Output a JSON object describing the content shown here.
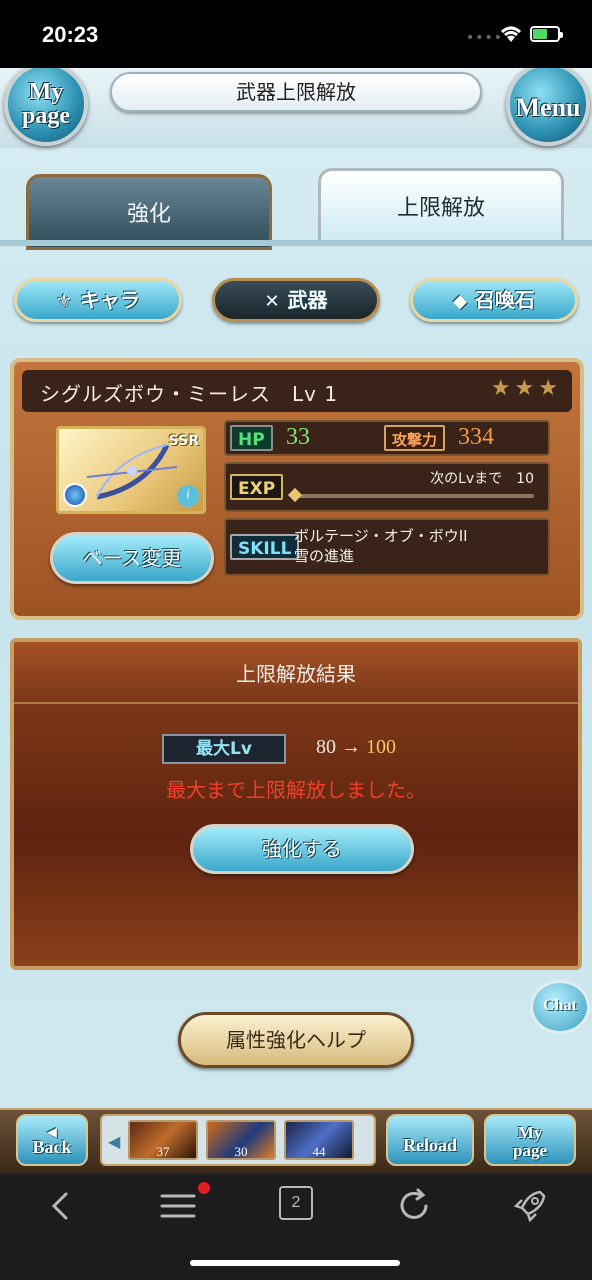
{
  "status_bar": {
    "time": "20:23"
  },
  "header": {
    "title": "武器上限解放",
    "mypage_label": "My\npage",
    "menu_label": "Menu"
  },
  "tabs": [
    {
      "label": "強化",
      "active": false
    },
    {
      "label": "上限解放",
      "active": true
    }
  ],
  "categories": [
    {
      "label": "キャラ",
      "icon": "chara-icon"
    },
    {
      "label": "武器",
      "icon": "sword-icon",
      "selected": true
    },
    {
      "label": "召喚石",
      "icon": "crystal-icon"
    }
  ],
  "weapon": {
    "name": "シグルズボウ・ミーレス",
    "level": "Lv 1",
    "rarity": "SSR",
    "stars": "★★★",
    "hp_label": "HP",
    "hp": "33",
    "atk_label": "攻撃力",
    "atk": "334",
    "exp_label": "EXP",
    "next_lv": "次のLvまで　10",
    "skill_label": "SKILL",
    "skills": [
      "ボルテージ・オブ・ボウII",
      "雪の進進"
    ],
    "base_change_label": "ベース変更"
  },
  "result": {
    "title": "上限解放結果",
    "max_lv_label": "最大Lv",
    "lv_from": "80 →",
    "lv_to": "100",
    "message": "最大まで上限解放しました。",
    "enhance_button": "強化する"
  },
  "help_button": "属性強化ヘルプ",
  "chat_button": "Chat",
  "bottom_bar": {
    "back": "Back",
    "reload": "Reload",
    "mypage": "My\npage",
    "items": [
      "37",
      "30",
      "44"
    ]
  },
  "browser": {
    "tab_count": "2"
  },
  "colors": {
    "accent_blue": "#3aa8cb",
    "panel_brown": "#9c5324",
    "result_red": "#f0402a",
    "hp_green": "#54e27a",
    "atk_orange": "#f39a4d"
  }
}
